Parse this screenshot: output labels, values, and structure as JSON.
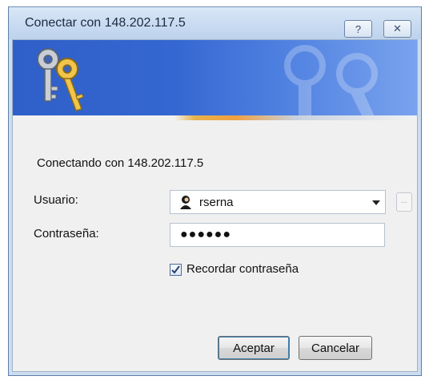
{
  "window": {
    "title": "Conectar con 148.202.117.5",
    "help_label": "?",
    "close_label": "✕"
  },
  "main": {
    "connecting_text": "Conectando con 148.202.117.5",
    "username_label": "Usuario:",
    "username_value": "rserna",
    "password_label": "Contraseña:",
    "password_value": "●●●●●●",
    "browse_label": "...",
    "remember_label": "Recordar contraseña",
    "remember_checked": true
  },
  "buttons": {
    "ok_label": "Aceptar",
    "cancel_label": "Cancelar"
  },
  "icons": {
    "banner": "keys-icon",
    "user": "user-icon",
    "dropdown": "chevron-down-icon"
  }
}
